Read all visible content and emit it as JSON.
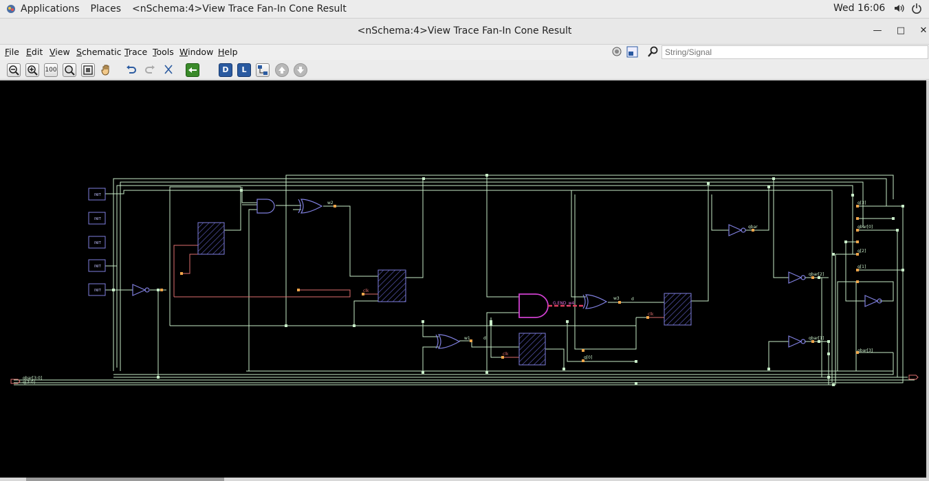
{
  "topbar": {
    "applications": "Applications",
    "places": "Places",
    "window_title": "<nSchema:4>View Trace Fan-In Cone Result",
    "clock": "Wed 16:06"
  },
  "window": {
    "title": "<nSchema:4>View Trace Fan-In Cone Result"
  },
  "menubar": {
    "items": [
      {
        "underline": "F",
        "rest": "ile"
      },
      {
        "underline": "E",
        "rest": "dit"
      },
      {
        "underline": "V",
        "rest": "iew"
      },
      {
        "underline": "S",
        "rest": "chematic"
      },
      {
        "underline": "T",
        "rest": "race"
      },
      {
        "underline": "T",
        "rest": "ools"
      },
      {
        "underline": "W",
        "rest": "indow"
      },
      {
        "underline": "H",
        "rest": "elp"
      }
    ]
  },
  "search": {
    "placeholder": "String/Signal"
  },
  "toolbar": {
    "zoom_100": "100",
    "d_label": "D",
    "l_label": "L"
  },
  "schematic": {
    "init_label": "INIT",
    "bus_in_label": "qbar[3:0]",
    "bus_in_label2": "q[3:0]",
    "net_w1": "w1",
    "net_w2": "w2",
    "net_w3": "w3",
    "net_d": "d",
    "net_clk": "clk",
    "and_out": "G.END_w4",
    "q0": "q[0]",
    "q1": "q[1]",
    "q2": "q[2]",
    "q3": "q[3]",
    "qbar_label": "qbar",
    "qbar0": "qbar[0]",
    "qbar1": "qbar[1]",
    "qbar2": "qbar[2]",
    "qbar3": "qbar[3]",
    "small_labels": [
      "b",
      "b",
      "b",
      "qbar[0]",
      "p",
      "clk",
      "qb",
      "q[0]",
      "q[0]",
      "b",
      "b",
      "q[0]",
      "q[0]",
      "d",
      "d",
      "q[3]"
    ]
  },
  "colors": {
    "wire": "#c8ecc8",
    "gate": "#8080e0",
    "highlight": "#d040d0",
    "pin": "#f2a64a",
    "red_wire": "#e07070"
  }
}
